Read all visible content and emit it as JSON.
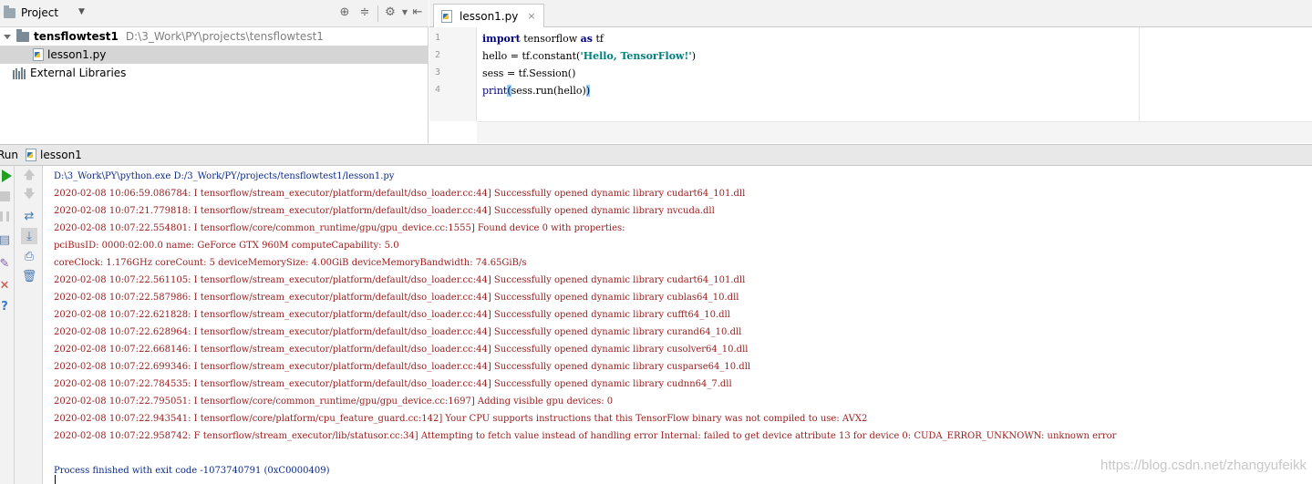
{
  "project_panel": {
    "title": "Project",
    "dropdown_glyph": "▼",
    "tools": [
      "target-icon",
      "collapse-icon",
      "gear-icon",
      "hide-icon"
    ],
    "tree": [
      {
        "name": "tensflowtest1",
        "path": "D:\\3_Work\\PY\\projects\\tensflowtest1",
        "type": "folder",
        "expanded": true
      },
      {
        "name": "lesson1.py",
        "type": "python-file",
        "selected": true
      },
      {
        "name": "External Libraries",
        "type": "libraries"
      }
    ]
  },
  "editor": {
    "tab_label": "lesson1.py",
    "tab_close": "×",
    "line_numbers": [
      "1",
      "2",
      "3",
      "4"
    ],
    "lines": [
      {
        "kw": "import",
        "rest": " tensorflow ",
        "kw2": "as",
        "rest2": " tf"
      },
      {
        "pre": "hello = tf.constant(",
        "str": "'Hello, TensorFlow!'",
        "post": ")"
      },
      {
        "pre": "sess = tf.Session()"
      },
      {
        "pre": "print",
        "b1": "(",
        "mid": "sess.run(hello)",
        "b2": ")"
      }
    ]
  },
  "run_panel": {
    "label": "Run",
    "config_name": "lesson1"
  },
  "console": {
    "lines": [
      {
        "text": "D:\\3_Work\\PY\\python.exe D:/3_Work/PY/projects/tensflowtest1/lesson1.py",
        "color": "blue"
      },
      {
        "text": "2020-02-08 10:06:59.086784: I tensorflow/stream_executor/platform/default/dso_loader.cc:44] Successfully opened dynamic library cudart64_101.dll",
        "color": "red"
      },
      {
        "text": "2020-02-08 10:07:21.779818: I tensorflow/stream_executor/platform/default/dso_loader.cc:44] Successfully opened dynamic library nvcuda.dll",
        "color": "red"
      },
      {
        "text": "2020-02-08 10:07:22.554801: I tensorflow/core/common_runtime/gpu/gpu_device.cc:1555] Found device 0 with properties:",
        "color": "red"
      },
      {
        "text": "pciBusID: 0000:02:00.0 name: GeForce GTX 960M computeCapability: 5.0",
        "color": "red"
      },
      {
        "text": "coreClock: 1.176GHz coreCount: 5 deviceMemorySize: 4.00GiB deviceMemoryBandwidth: 74.65GiB/s",
        "color": "red"
      },
      {
        "text": "2020-02-08 10:07:22.561105: I tensorflow/stream_executor/platform/default/dso_loader.cc:44] Successfully opened dynamic library cudart64_101.dll",
        "color": "red"
      },
      {
        "text": "2020-02-08 10:07:22.587986: I tensorflow/stream_executor/platform/default/dso_loader.cc:44] Successfully opened dynamic library cublas64_10.dll",
        "color": "red"
      },
      {
        "text": "2020-02-08 10:07:22.621828: I tensorflow/stream_executor/platform/default/dso_loader.cc:44] Successfully opened dynamic library cufft64_10.dll",
        "color": "red"
      },
      {
        "text": "2020-02-08 10:07:22.628964: I tensorflow/stream_executor/platform/default/dso_loader.cc:44] Successfully opened dynamic library curand64_10.dll",
        "color": "red"
      },
      {
        "text": "2020-02-08 10:07:22.668146: I tensorflow/stream_executor/platform/default/dso_loader.cc:44] Successfully opened dynamic library cusolver64_10.dll",
        "color": "red"
      },
      {
        "text": "2020-02-08 10:07:22.699346: I tensorflow/stream_executor/platform/default/dso_loader.cc:44] Successfully opened dynamic library cusparse64_10.dll",
        "color": "red"
      },
      {
        "text": "2020-02-08 10:07:22.784535: I tensorflow/stream_executor/platform/default/dso_loader.cc:44] Successfully opened dynamic library cudnn64_7.dll",
        "color": "red"
      },
      {
        "text": "2020-02-08 10:07:22.795051: I tensorflow/core/common_runtime/gpu/gpu_device.cc:1697] Adding visible gpu devices: 0",
        "color": "red"
      },
      {
        "text": "2020-02-08 10:07:22.943541: I tensorflow/core/platform/cpu_feature_guard.cc:142] Your CPU supports instructions that this TensorFlow binary was not compiled to use: AVX2",
        "color": "red"
      },
      {
        "text": "2020-02-08 10:07:22.958742: F tensorflow/stream_executor/lib/statusor.cc:34] Attempting to fetch value instead of handling error Internal: failed to get device attribute 13 for device 0: CUDA_ERROR_UNKNOWN: unknown error",
        "color": "red"
      },
      {
        "text": "",
        "color": "blue"
      },
      {
        "text": "Process finished with exit code -1073740791 (0xC0000409)",
        "color": "blue"
      }
    ]
  },
  "watermark": "https://blog.csdn.net/zhangyufeikk",
  "colors": {
    "console_blue": "#0b2a86",
    "console_red": "#9b1a1a",
    "keyword": "#000080",
    "string": "#008080",
    "run_green": "#22a022"
  }
}
